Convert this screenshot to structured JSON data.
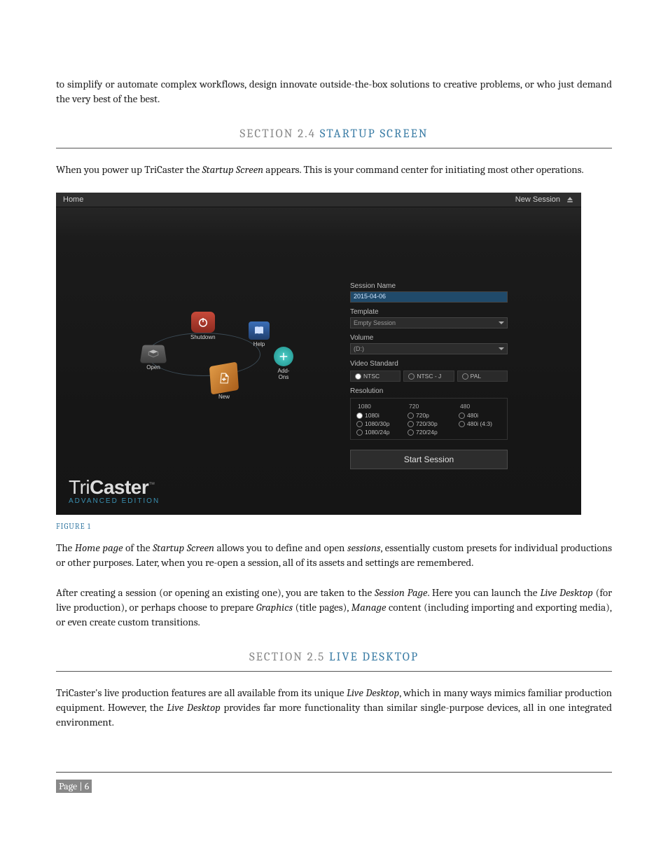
{
  "para1_a": "to simplify or automate complex workflows, design innovate outside-the-box solutions to creative problems, or who just demand the very best of the best.",
  "section24_prefix": "SECTION 2.4",
  "section24_title": "STARTUP SCREEN",
  "para2_a": "When you power up TriCaster the ",
  "para2_em1": "Startup Screen",
  "para2_b": " appears.  This is your command center for initiating most other operations.",
  "fig_caption": "FIGURE 1",
  "para3_a": "The ",
  "para3_em1": "Home page",
  "para3_b": " of the ",
  "para3_em2": "Startup Screen",
  "para3_c": " allows you to define and open ",
  "para3_em3": "sessions",
  "para3_d": ", essentially custom presets for individual productions or other purposes.  Later, when you re-open a session, all of its assets and settings are remembered.",
  "para4_a": "After creating a session (or opening an existing one), you are taken to the ",
  "para4_em1": "Session Page",
  "para4_b": ". Here you can launch the ",
  "para4_em2": "Live Desktop",
  "para4_c": " (for live production), or perhaps choose to prepare ",
  "para4_em3": "Graphics",
  "para4_d": " (title pages), ",
  "para4_em4": "Manage",
  "para4_e": " content (including importing and exporting media), or even create custom transitions.",
  "section25_prefix": "SECTION 2.5",
  "section25_title": "LIVE DESKTOP",
  "para5_a": "TriCaster's live production features are all available from its unique ",
  "para5_em1": "Live Desktop",
  "para5_b": ", which in many ways mimics familiar production equipment.  However, the ",
  "para5_em2": "Live Desktop",
  "para5_c": " provides far more functionality than similar single-purpose devices, all in one integrated environment.",
  "page_number": "Page | 6",
  "ss": {
    "home": "Home",
    "new_session": "New Session",
    "nodes": {
      "shutdown": "Shutdown",
      "help": "Help",
      "addons": "Add-Ons",
      "new": "New",
      "open": "Open"
    },
    "logo_line1a": "Tri",
    "logo_line1b": "Caster",
    "logo_tm": "™",
    "logo_line2": "ADVANCED EDITION",
    "form": {
      "session_name_label": "Session Name",
      "session_name_value": "2015-04-06",
      "template_label": "Template",
      "template_value": "Empty Session",
      "volume_label": "Volume",
      "volume_value": "(D:)",
      "video_std_label": "Video Standard",
      "vs": {
        "ntsc": "NTSC",
        "ntscj": "NTSC - J",
        "pal": "PAL"
      },
      "resolution_label": "Resolution",
      "res": {
        "c1_hdr": "1080",
        "c1_a": "1080i",
        "c1_b": "1080/30p",
        "c1_c": "1080/24p",
        "c2_hdr": "720",
        "c2_a": "720p",
        "c2_b": "720/30p",
        "c2_c": "720/24p",
        "c3_hdr": "480",
        "c3_a": "480i",
        "c3_b": "480i (4:3)"
      },
      "start": "Start Session"
    }
  }
}
